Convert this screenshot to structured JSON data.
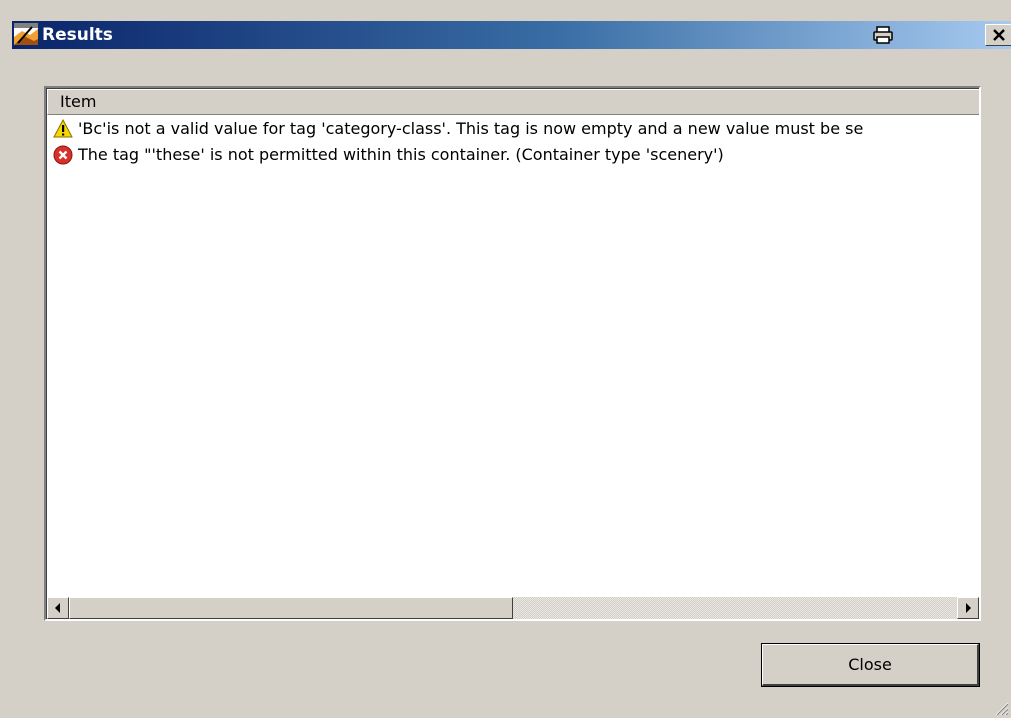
{
  "window": {
    "title": "Results",
    "icon": "app-icon",
    "title_buttons": [
      "print-icon",
      "close-icon"
    ]
  },
  "list": {
    "column_header": "Item",
    "rows": [
      {
        "severity": "warning",
        "icon": "warning-icon",
        "text": "'Bc'is not a valid value for tag 'category-class'.  This tag is now empty and a new value must be se"
      },
      {
        "severity": "error",
        "icon": "error-icon",
        "text": "The tag \"'these' is not permitted within this container. (Container type 'scenery')"
      }
    ]
  },
  "scrollbar": {
    "position": 0
  },
  "buttons": {
    "close_label": "Close"
  },
  "colors": {
    "title_start": "#0a246a",
    "title_end": "#a6caf0",
    "face": "#d4d0c8",
    "warning": "#f5d800",
    "error": "#d9302b"
  }
}
